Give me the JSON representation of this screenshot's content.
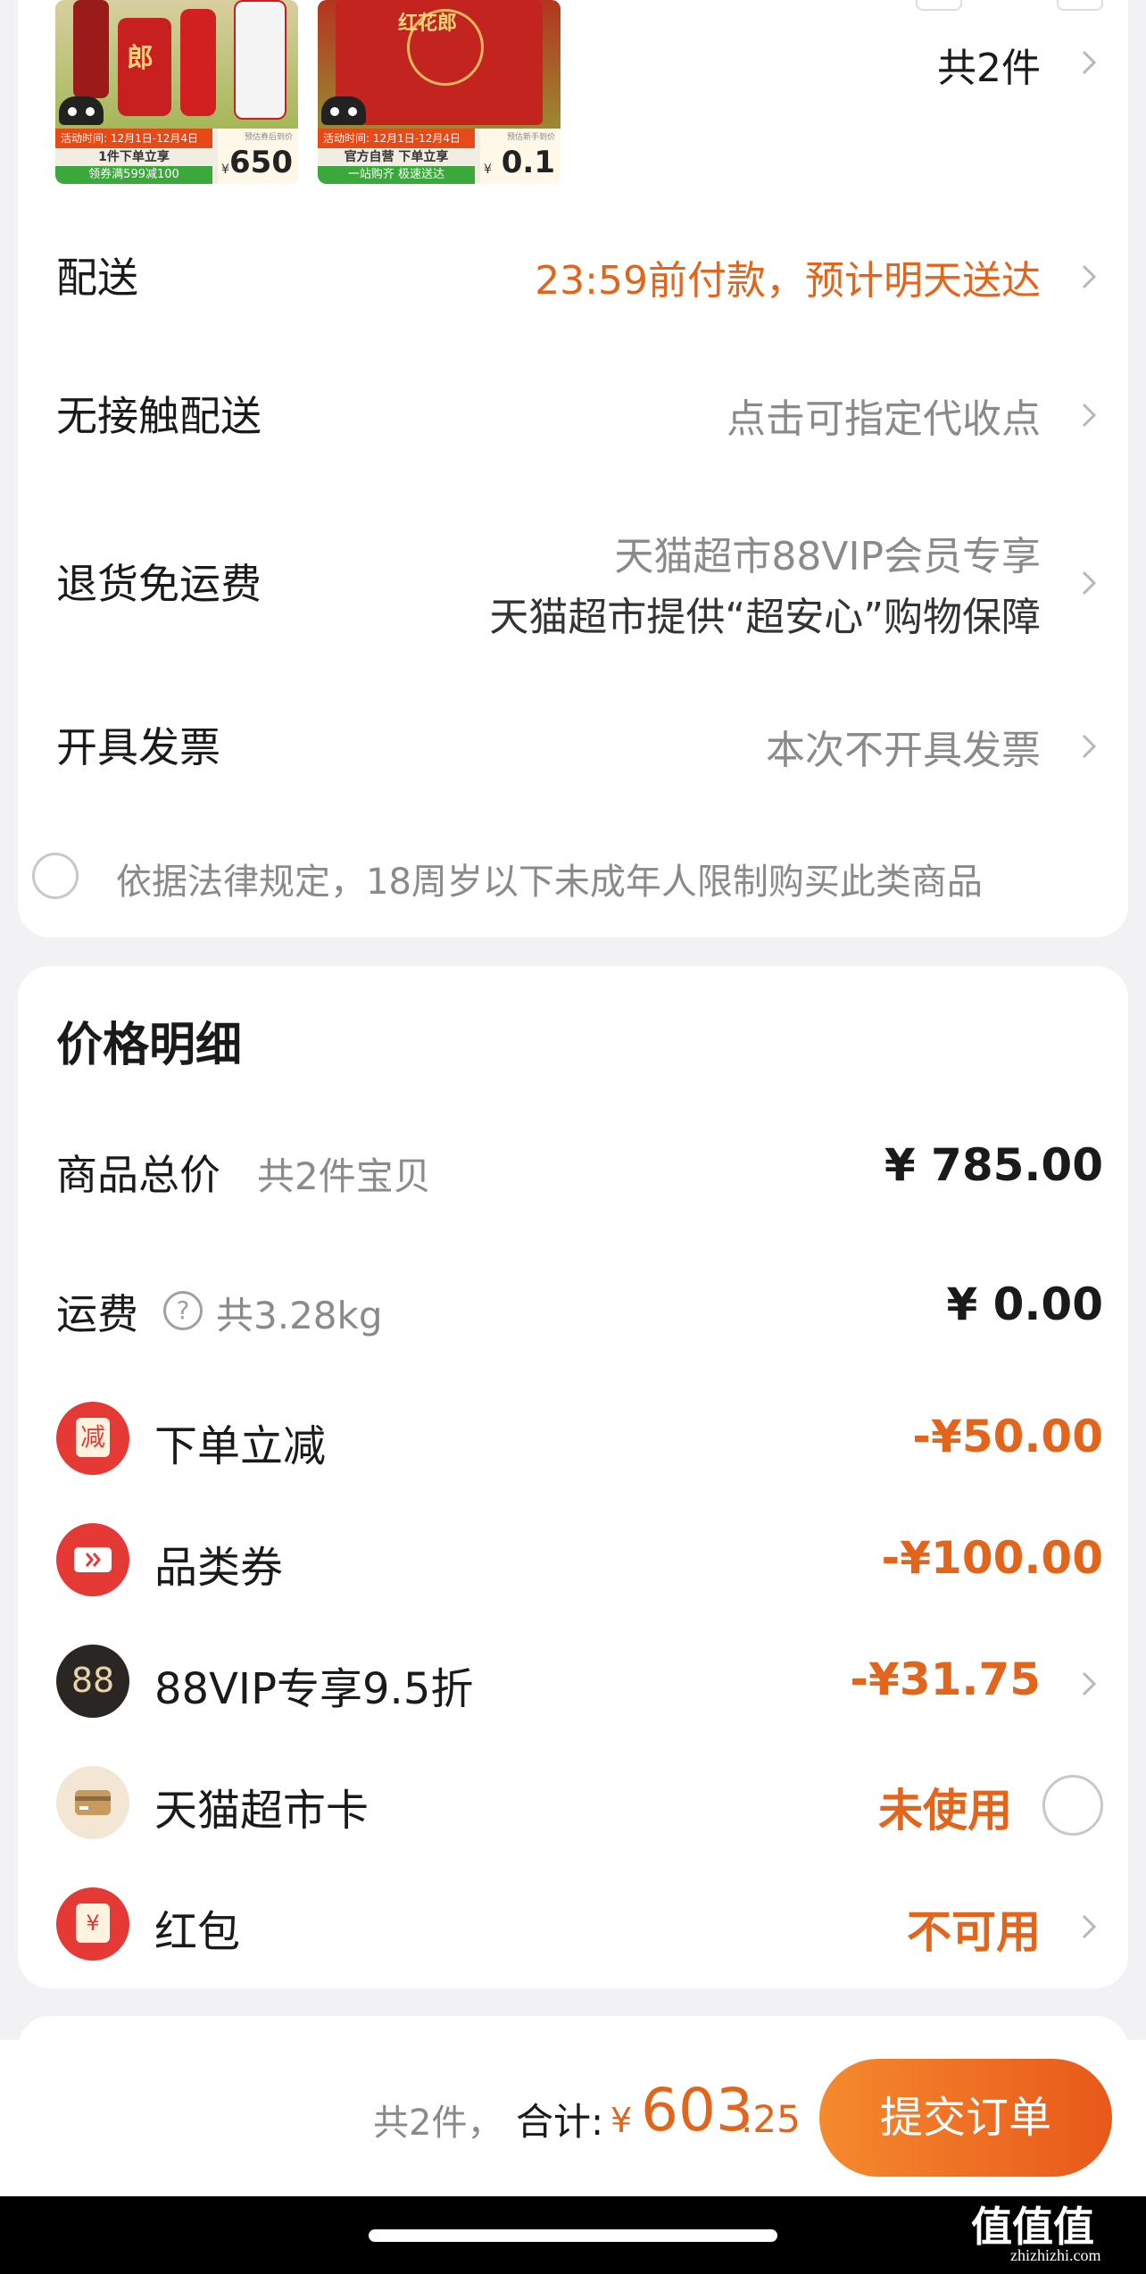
{
  "products": {
    "count_label": "共2件",
    "items": [
      {
        "promo_dates": "活动时间: 12月1日-12月4日",
        "promo_text": "1件下单立享",
        "coupon_text": "领券满599减100",
        "price_tag": "预估券后到价",
        "currency": "¥",
        "price": "650",
        "bottle_text": "郎"
      },
      {
        "promo_dates": "活动时间: 12月1日-12月4日",
        "promo_text": "官方自营 下单立享",
        "coupon_text": "一站购齐 极速送达",
        "price_tag": "预估新手到价",
        "currency": "¥",
        "price": "0.1",
        "bottle_text": "红花郎"
      }
    ]
  },
  "order_rows": {
    "delivery": {
      "label": "配送",
      "value": "23:59前付款，预计明天送达"
    },
    "contactless": {
      "label": "无接触配送",
      "value": "点击可指定代收点"
    },
    "return_shipping": {
      "label": "退货免运费",
      "value_line1": "天猫超市88VIP会员专享",
      "value_line2": "天猫超市提供“超安心”购物保障"
    },
    "invoice": {
      "label": "开具发票",
      "value": "本次不开具发票"
    },
    "age_notice": "依据法律规定，18周岁以下未成年人限制购买此类商品"
  },
  "price_detail": {
    "title": "价格明细",
    "subtotal": {
      "label": "商品总价",
      "sub": "共2件宝贝",
      "value": "¥ 785.00"
    },
    "shipping": {
      "label": "运费",
      "sub": "共3.28kg",
      "value": "¥ 0.00"
    },
    "discounts": [
      {
        "icon": "instant-reduction-icon",
        "icon_text": "减",
        "label": "下单立减",
        "value": "-¥50.00",
        "color": "#e3641b"
      },
      {
        "icon": "coupon-icon",
        "label": "品类券",
        "value": "-¥100.00",
        "color": "#e3641b"
      },
      {
        "icon": "88vip-icon",
        "icon_text": "88",
        "label": "88VIP专享9.5折",
        "value": "-¥31.75",
        "color": "#e3641b"
      },
      {
        "icon": "supermarket-card-icon",
        "label": "天猫超市卡",
        "value": "未使用",
        "color": "#e3641b"
      },
      {
        "icon": "red-packet-icon",
        "icon_text": "¥",
        "label": "红包",
        "value": "不可用",
        "color": "#e3641b"
      }
    ]
  },
  "footer": {
    "count": "共2件，",
    "total_label": "合计:",
    "currency": "¥",
    "total_int": "603",
    "total_dec": ".25",
    "submit_label": "提交订单"
  },
  "watermark": {
    "main": "值值值",
    "domain": "zhizhizhi.com"
  },
  "colors": {
    "accent": "#e3641b",
    "button_gradient_start": "#f58a2e",
    "button_gradient_end": "#e8581a",
    "red_icon": "#e53935"
  }
}
